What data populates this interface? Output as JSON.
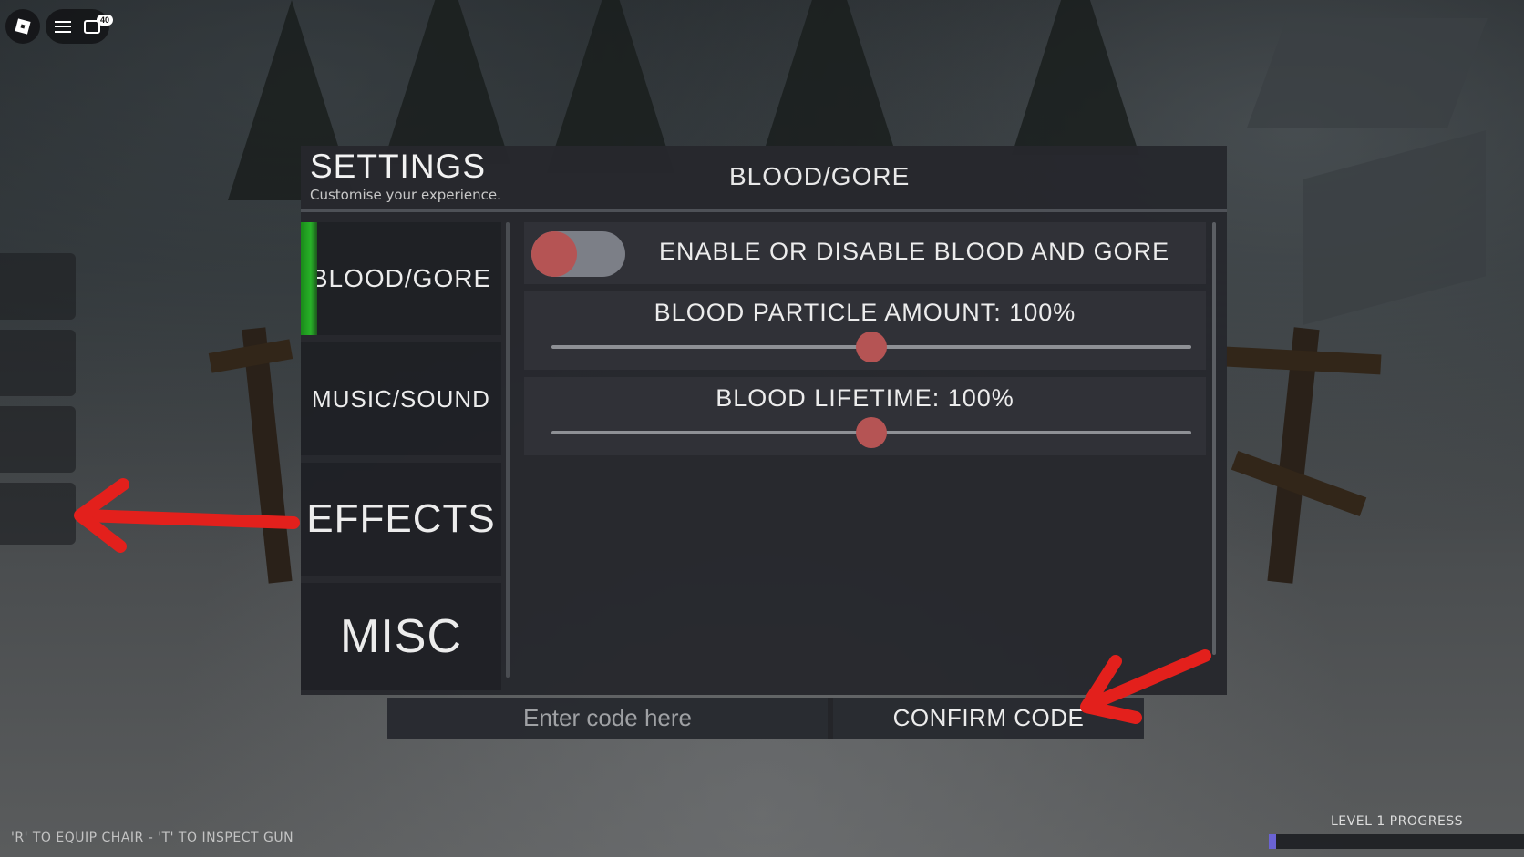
{
  "topbar": {
    "chat_badge": "40"
  },
  "settings": {
    "title": "SETTINGS",
    "subtitle": "Customise your experience.",
    "section_title": "BLOOD/GORE",
    "nav": [
      {
        "label": "BLOOD/GORE",
        "active": true
      },
      {
        "label": "MUSIC/SOUND",
        "active": false
      },
      {
        "label": "EFFECTS",
        "active": false
      },
      {
        "label": "MISC",
        "active": false
      }
    ],
    "toggle": {
      "label": "ENABLE OR DISABLE BLOOD AND GORE",
      "enabled": false
    },
    "sliders": [
      {
        "label": "BLOOD PARTICLE AMOUNT: 100%",
        "value": 0.5
      },
      {
        "label": "BLOOD LIFETIME: 100%",
        "value": 0.5
      }
    ]
  },
  "code": {
    "placeholder": "Enter code here",
    "confirm_label": "CONFIRM CODE"
  },
  "hud": {
    "hint": "'R' TO EQUIP CHAIR - 'T' TO INSPECT GUN",
    "level_label": "LEVEL 1 PROGRESS",
    "level_progress": 0.03
  },
  "colors": {
    "accent_active": "#28b128",
    "knob": "#b55454",
    "arrow": "#e3201c",
    "level_fill": "#6a63d4"
  }
}
